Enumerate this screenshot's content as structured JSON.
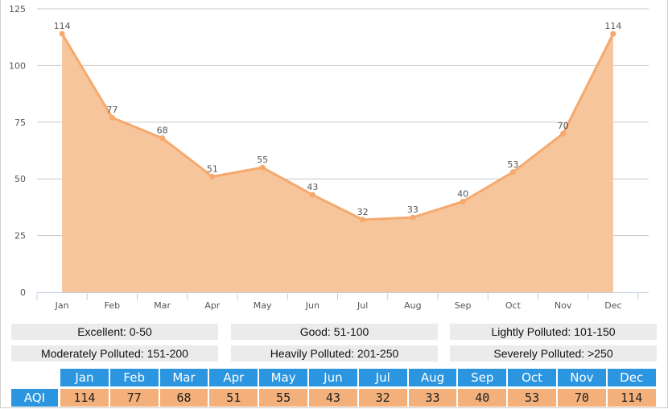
{
  "chart_data": {
    "type": "area",
    "title": "",
    "xlabel": "",
    "ylabel": "",
    "categories": [
      "Jan",
      "Feb",
      "Mar",
      "Apr",
      "May",
      "Jun",
      "Jul",
      "Aug",
      "Sep",
      "Oct",
      "Nov",
      "Dec"
    ],
    "series": [
      {
        "name": "AQI",
        "values": [
          114,
          77,
          68,
          51,
          55,
          43,
          32,
          33,
          40,
          53,
          70,
          114
        ]
      }
    ],
    "ylim": [
      0,
      125
    ],
    "yticks": [
      0,
      25,
      50,
      75,
      100,
      125
    ],
    "grid": true,
    "legend": "none",
    "colors": {
      "line": "#f5a96e",
      "fill": "#f6c59b",
      "grid": "#c8c8c8",
      "axis": "#c0d0e0"
    }
  },
  "legend_boxes": [
    "Excellent: 0-50",
    "Good: 51-100",
    "Lightly Polluted: 101-150",
    "Moderately Polluted: 151-200",
    "Heavily Polluted: 201-250",
    "Severely Polluted: >250"
  ],
  "table": {
    "row_label": "AQI",
    "months": [
      "Jan",
      "Feb",
      "Mar",
      "Apr",
      "May",
      "Jun",
      "Jul",
      "Aug",
      "Sep",
      "Oct",
      "Nov",
      "Dec"
    ],
    "values": [
      "114",
      "77",
      "68",
      "51",
      "55",
      "43",
      "32",
      "33",
      "40",
      "53",
      "70",
      "114"
    ],
    "header_color": "#2b95e0",
    "value_color": "#f3b07a"
  }
}
